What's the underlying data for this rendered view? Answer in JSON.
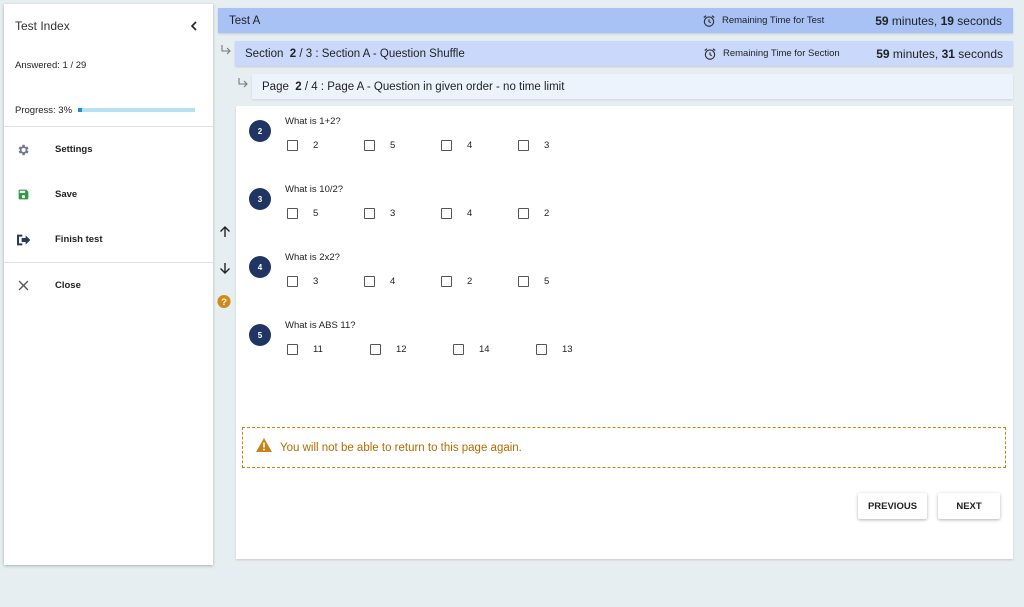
{
  "sidebar": {
    "title": "Test Index",
    "answered": "Answered: 1 / 29",
    "progress_label": "Progress: 3%",
    "progress_percent": 3,
    "items": [
      {
        "label": "Settings"
      },
      {
        "label": "Save"
      },
      {
        "label": "Finish test"
      },
      {
        "label": "Close"
      }
    ]
  },
  "test": {
    "title": "Test A",
    "timer_label": "Remaining Time for Test",
    "minutes": "59",
    "minutes_unit": " minutes, ",
    "seconds": "19",
    "seconds_unit": " seconds"
  },
  "section": {
    "prefix": "Section ",
    "current": "2",
    "sep": " / ",
    "total": "3",
    "name": " : Section A - Question Shuffle",
    "timer_label": "Remaining Time for Section",
    "minutes": "59",
    "minutes_unit": " minutes, ",
    "seconds": "31",
    "seconds_unit": " seconds"
  },
  "page": {
    "prefix": "Page ",
    "current": "2",
    "sep": " / ",
    "total": "4",
    "name": " : Page A - Question in given order - no time limit"
  },
  "questions": [
    {
      "num": "2",
      "text": "What is 1+2?",
      "options": [
        "2",
        "5",
        "4",
        "3"
      ]
    },
    {
      "num": "3",
      "text": "What is 10/2?",
      "options": [
        "5",
        "3",
        "4",
        "2"
      ]
    },
    {
      "num": "4",
      "text": "What is 2x2?",
      "options": [
        "3",
        "4",
        "2",
        "5"
      ]
    },
    {
      "num": "5",
      "text": "What is ABS 11?",
      "options": [
        "11",
        "12",
        "14",
        "13"
      ]
    }
  ],
  "warning": "You will not be able to return to this page again.",
  "buttons": {
    "previous": "PREVIOUS",
    "next": "NEXT"
  },
  "colors": {
    "accent": "#213564",
    "warning": "#c48418",
    "help": "#d08a1c"
  }
}
